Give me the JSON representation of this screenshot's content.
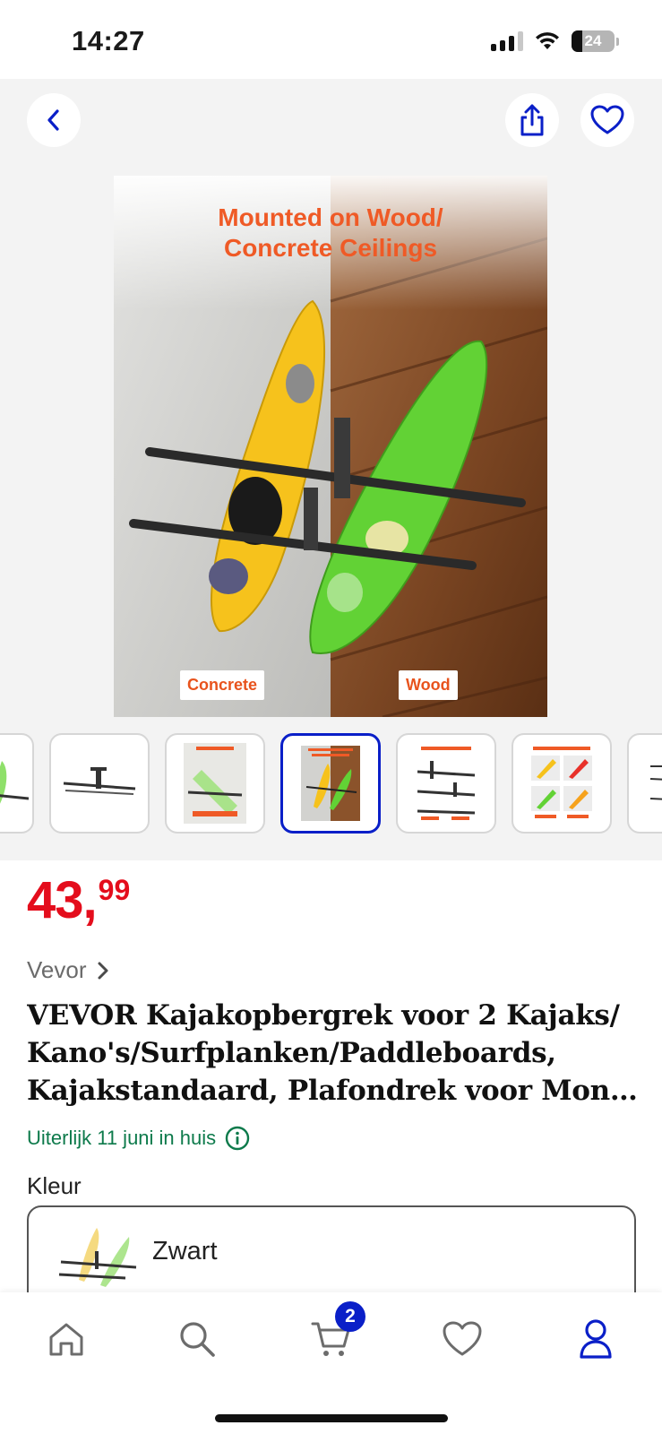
{
  "status_bar": {
    "time": "14:27",
    "battery": "24",
    "battery_level": 0.24,
    "icons": [
      "signal-icon",
      "wifi-icon",
      "battery-icon"
    ]
  },
  "gallery": {
    "hero_title_line1": "Mounted on Wood/",
    "hero_title_line2": "Concrete Ceilings",
    "hero_tag_left": "Concrete",
    "hero_tag_right": "Wood",
    "thumbnails": [
      {
        "name": "kayak-partial",
        "active": false
      },
      {
        "name": "rack-bar",
        "active": false,
        "caption": ""
      },
      {
        "name": "soft-support",
        "active": false,
        "caption": "Soft Support"
      },
      {
        "name": "mounted-on-wood",
        "active": true,
        "caption": "Mounted on Wood/ Concrete Ceilings"
      },
      {
        "name": "reinforced-structure",
        "active": false,
        "caption": "Reinforced Heavy-Duty Structure"
      },
      {
        "name": "multiple-uses",
        "active": false,
        "caption": "Designed for Multiple Uses"
      },
      {
        "name": "dimensions-partial",
        "active": false
      }
    ]
  },
  "product": {
    "price_main": "43,",
    "price_fraction": "99",
    "brand": "Vevor",
    "title_line1": "VEVOR Kajakopbergrek voor 2 Kajaks/",
    "title_line2": "Kano's/Surfplanken/Paddleboards,",
    "title_line3": "Kajakstandaard, Plafondrek voor Montage",
    "delivery": "Uiterlijk 11 juni in huis",
    "color_label": "Kleur",
    "color_value": "Zwart"
  },
  "bottom_nav": {
    "items": [
      "home",
      "search",
      "cart",
      "favorites",
      "account"
    ],
    "cart_badge": "2"
  },
  "colors": {
    "accent_blue": "#0a1fc8",
    "price_red": "#e40d1c",
    "delivery_green": "#0d7a4b",
    "hero_orange": "#ef5a26"
  }
}
